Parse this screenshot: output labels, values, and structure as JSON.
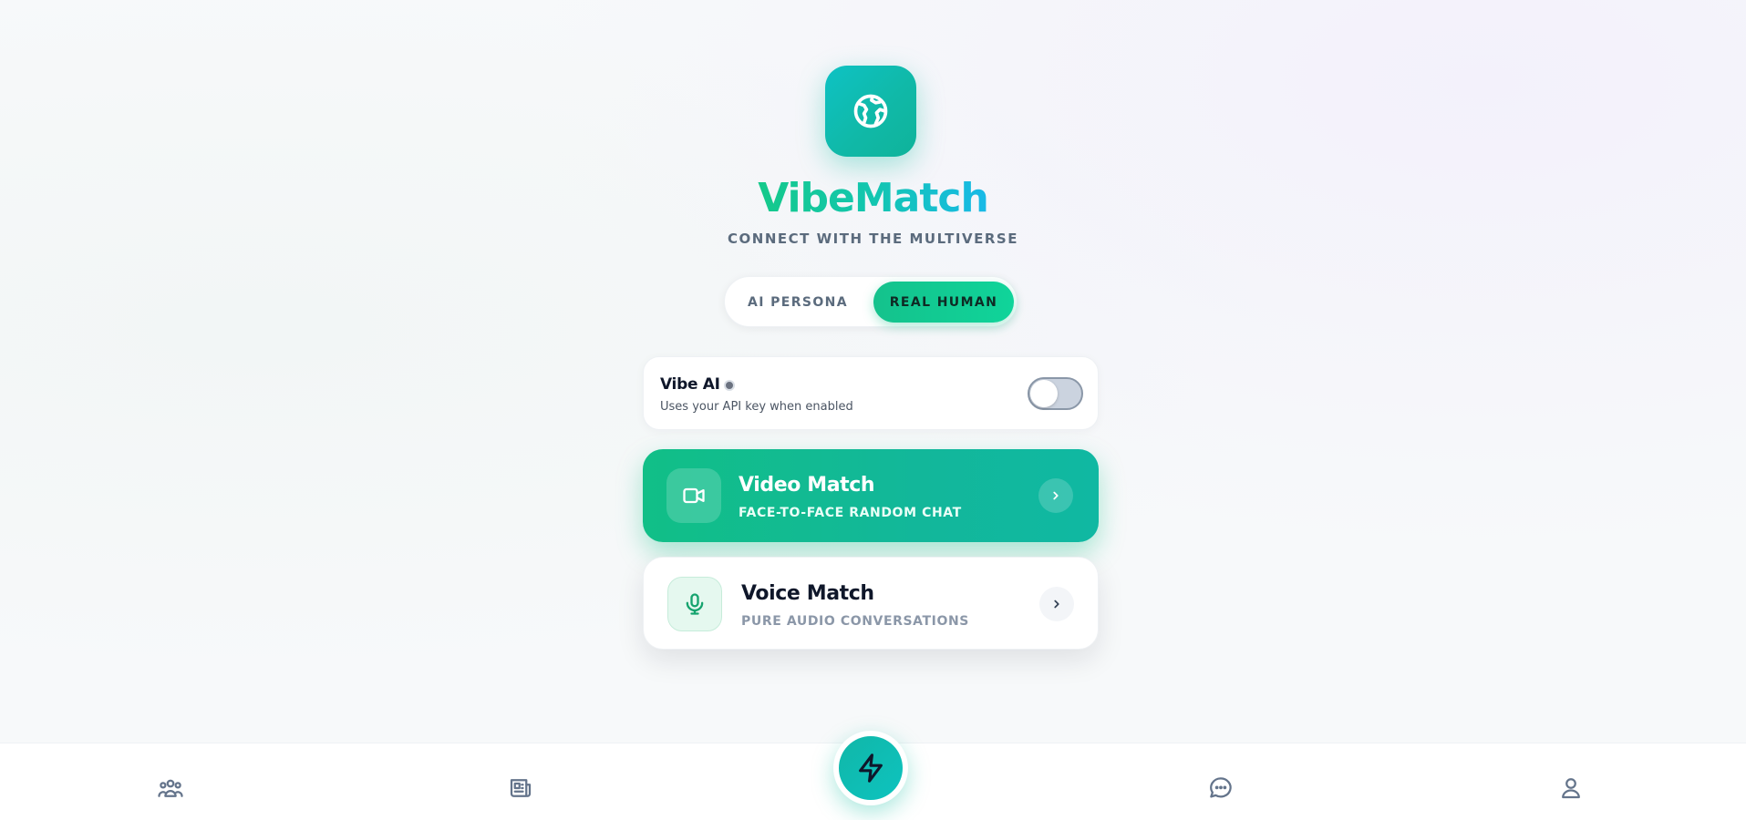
{
  "app": {
    "name": "VibeMatch",
    "tagline": "CONNECT WITH THE MULTIVERSE",
    "logo_icon": "globe-icon",
    "accent_color": "#14c28c"
  },
  "mode_toggle": {
    "options": [
      "AI PERSONA",
      "REAL HUMAN"
    ],
    "selected": "REAL HUMAN"
  },
  "vibe_ai": {
    "title": "Vibe AI",
    "description": "Uses your API key when enabled",
    "enabled": false
  },
  "matches": {
    "video": {
      "title": "Video Match",
      "subtitle": "FACE-TO-FACE RANDOM CHAT",
      "icon": "video-camera-icon"
    },
    "voice": {
      "title": "Voice Match",
      "subtitle": "PURE AUDIO CONVERSATIONS",
      "icon": "microphone-icon"
    }
  },
  "bottom_nav": {
    "items": [
      "community-icon",
      "feed-icon",
      "lightning-icon",
      "chat-icon",
      "profile-icon"
    ],
    "active": "lightning-icon"
  }
}
